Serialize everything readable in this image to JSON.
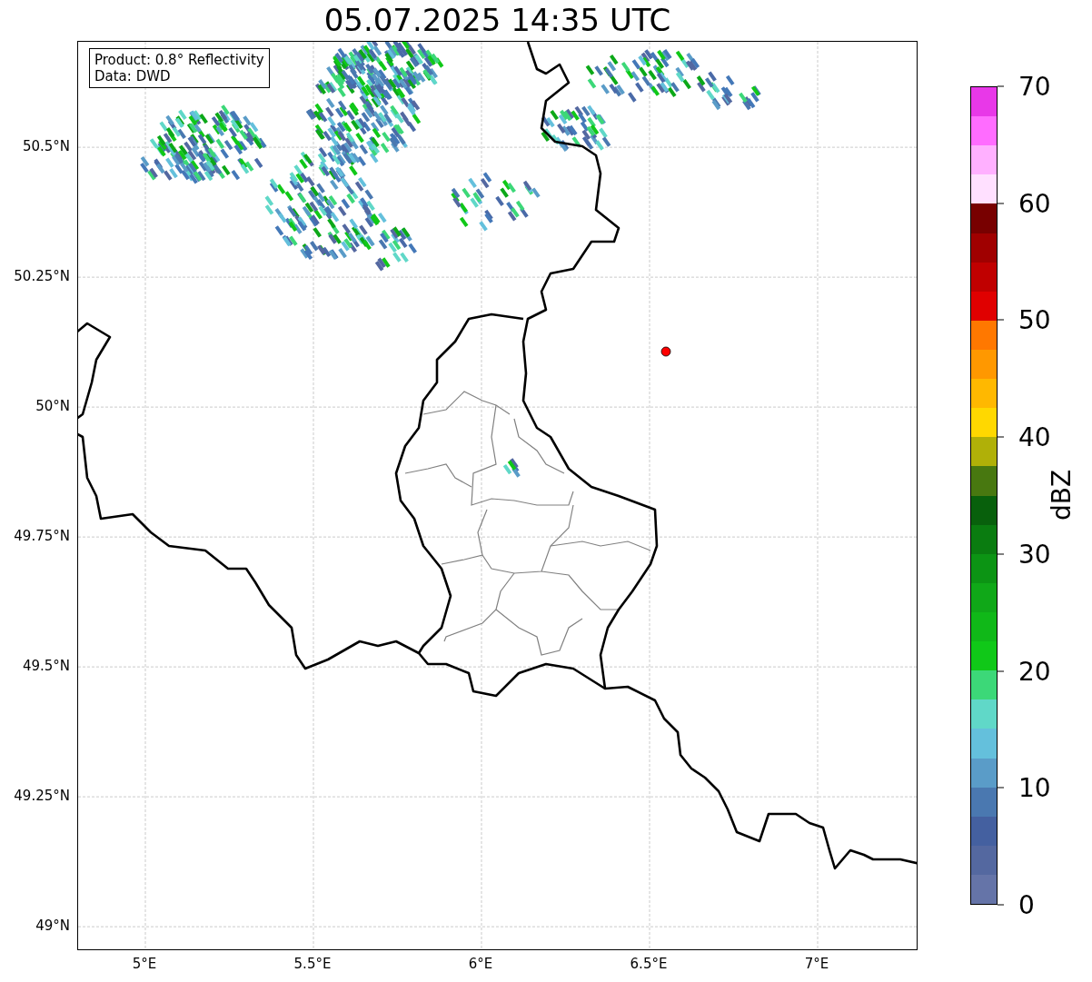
{
  "title": "05.07.2025 14:35 UTC",
  "annotation": {
    "lines": [
      "Product: 0.8° Reflectivity",
      "Data: DWD"
    ]
  },
  "map": {
    "x_ticks": [
      "5°E",
      "5.5°E",
      "6°E",
      "6.5°E",
      "7°E"
    ],
    "y_ticks": [
      "50.5°N",
      "50.25°N",
      "50°N",
      "49.75°N",
      "49.5°N",
      "49.25°N",
      "49°N"
    ]
  },
  "colorbar": {
    "label": "dBZ",
    "ticks": [
      "70",
      "60",
      "50",
      "40",
      "30",
      "20",
      "10",
      "0"
    ],
    "bins": [
      {
        "color": "#e838e8"
      },
      {
        "color": "#ff6cff"
      },
      {
        "color": "#ffb0ff"
      },
      {
        "color": "#ffe0ff"
      },
      {
        "color": "#780000"
      },
      {
        "color": "#a00000"
      },
      {
        "color": "#c00000"
      },
      {
        "color": "#e00000"
      },
      {
        "color": "#ff7800"
      },
      {
        "color": "#ff9800"
      },
      {
        "color": "#ffb800"
      },
      {
        "color": "#ffd800"
      },
      {
        "color": "#b0b008"
      },
      {
        "color": "#487810"
      },
      {
        "color": "#08600c"
      },
      {
        "color": "#0a7c10"
      },
      {
        "color": "#0c9414"
      },
      {
        "color": "#10a818"
      },
      {
        "color": "#10b818"
      },
      {
        "color": "#10c818"
      },
      {
        "color": "#3cd878"
      },
      {
        "color": "#60d8c8"
      },
      {
        "color": "#64c0dc"
      },
      {
        "color": "#5a9cc8"
      },
      {
        "color": "#4a78b0"
      },
      {
        "color": "#4460a0"
      },
      {
        "color": "#5468a0"
      },
      {
        "color": "#6574a8"
      }
    ]
  }
}
